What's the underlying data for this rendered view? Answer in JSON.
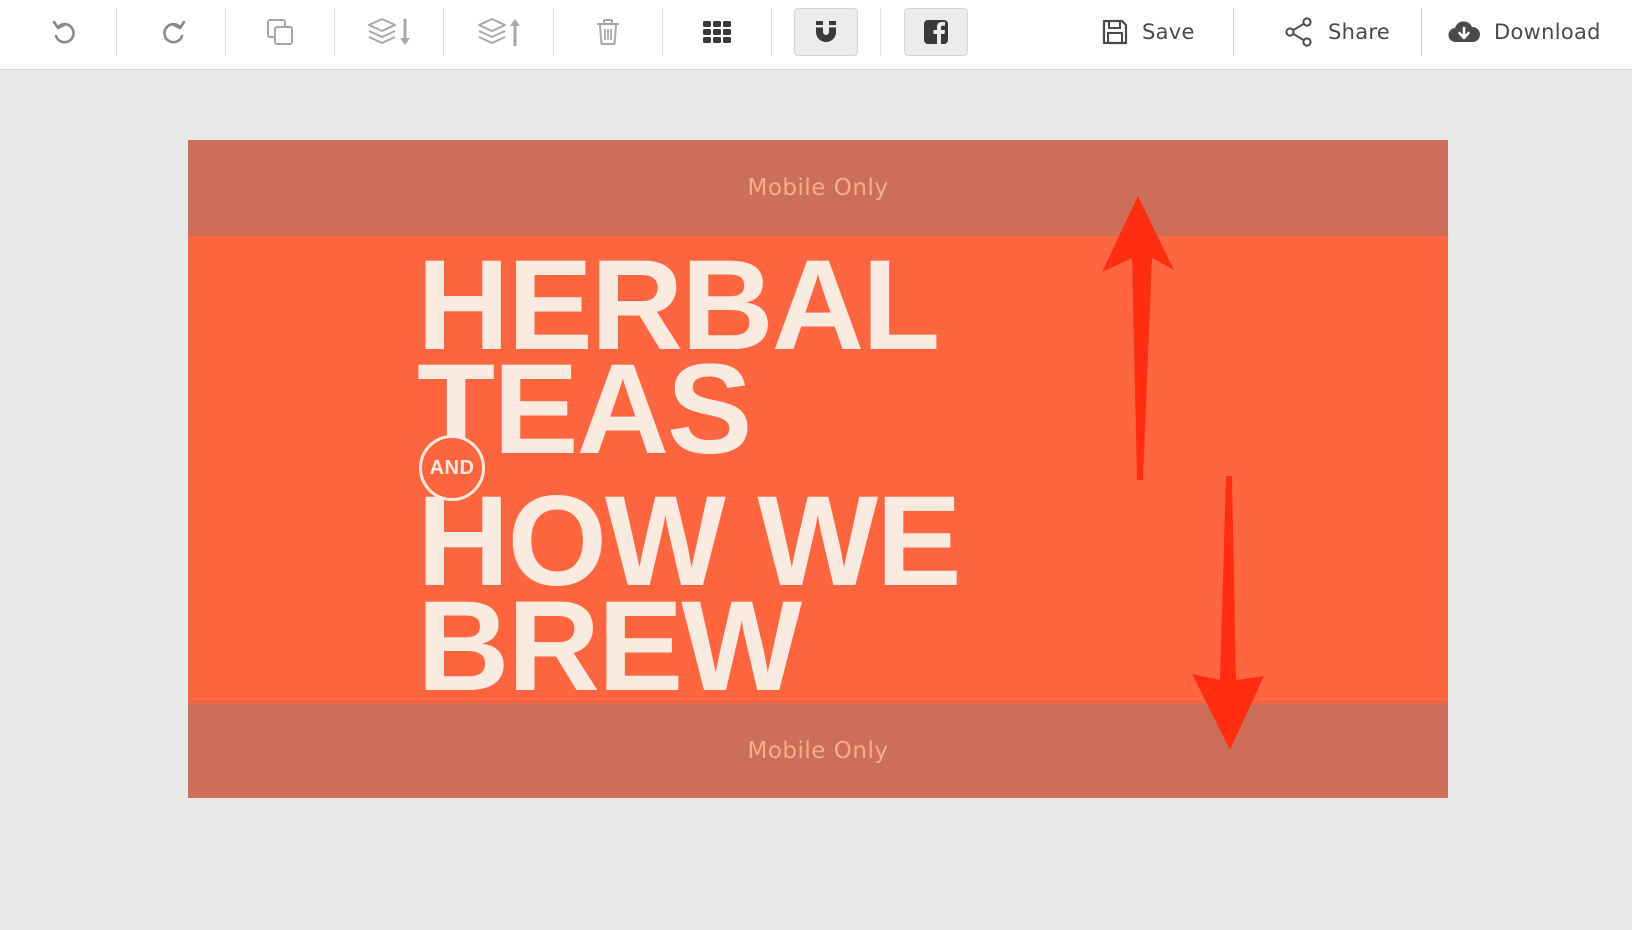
{
  "toolbar": {
    "tools": [
      {
        "name": "undo-icon"
      },
      {
        "name": "redo-icon"
      },
      {
        "name": "duplicate-icon"
      },
      {
        "name": "layer-down-icon"
      },
      {
        "name": "layer-up-icon"
      },
      {
        "name": "trash-icon"
      },
      {
        "name": "grid-icon"
      },
      {
        "name": "magnet-icon",
        "toggled": true
      },
      {
        "name": "facebook-icon",
        "toggled": true
      }
    ],
    "save_label": "Save",
    "share_label": "Share",
    "download_label": "Download"
  },
  "canvas": {
    "background": "#ff6640",
    "band_color": "#cc6e58",
    "top_band_label": "Mobile Only",
    "bottom_band_label": "Mobile Only",
    "headline_lines": [
      "HERBAL",
      "TEAS",
      "HOW WE",
      "BREW"
    ],
    "badge_text": "AND",
    "text_color": "#fbeae0"
  },
  "annotations": {
    "arrow_color": "#ff2e10",
    "arrows": [
      "up-arrow",
      "down-arrow"
    ]
  }
}
